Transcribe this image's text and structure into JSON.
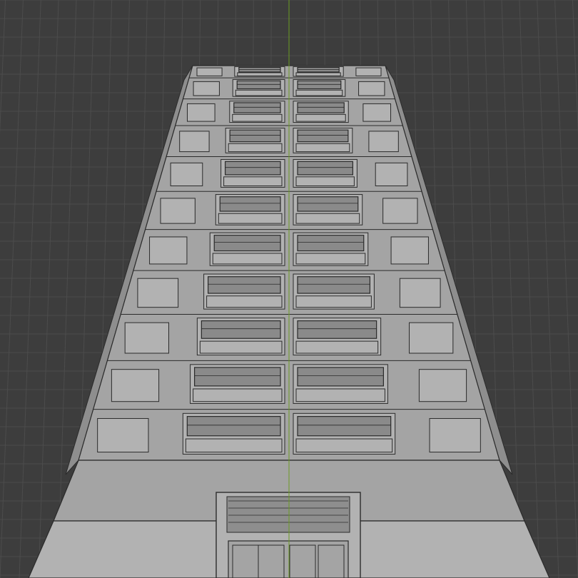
{
  "viewport": {
    "background": "#3d3d3d",
    "grid_minor_color": "#4c4c4c",
    "grid_major_color": "#555555",
    "axis_color": "#6b9a24",
    "mesh_face_color": "#a4a4a4",
    "mesh_light_color": "#b2b2b2",
    "mesh_dark_color": "#8e8e8e",
    "window_glass_color": "#8a8a8a",
    "wire_color": "#2b2b2b",
    "floors_above_ground": 11,
    "window_bays_per_floor": 2
  }
}
